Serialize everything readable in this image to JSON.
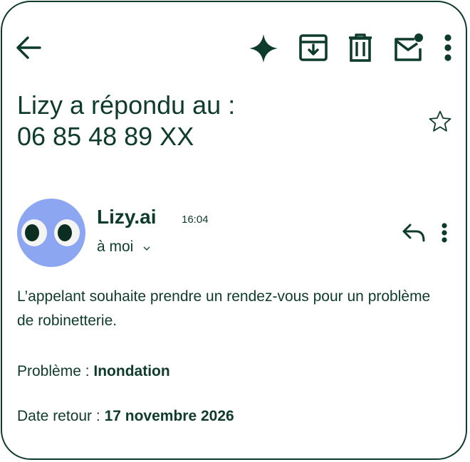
{
  "colors": {
    "ink": "#0e3b2c",
    "avatar_bg": "#8da6f2",
    "background": "#ffffff"
  },
  "toolbar": {
    "back_icon": "arrow-left-icon",
    "ai_icon": "sparkle-icon",
    "archive_icon": "archive-icon",
    "delete_icon": "trash-icon",
    "mark_unread_icon": "mail-unread-icon",
    "more_icon": "more-vert-icon"
  },
  "email": {
    "subject_line1": "Lizy a répondu au :",
    "subject_line2": "06 85 48 89 XX",
    "star_icon": "star-outline-icon",
    "sender": "Lizy.ai",
    "time": "16:04",
    "recipient": "à moi",
    "reply_icon": "reply-icon",
    "body": "L’appelant souhaite prendre un rendez-vous pour un problème de robinetterie.",
    "fields": [
      {
        "label": "Problème : ",
        "value": "Inondation"
      },
      {
        "label": "Date retour : ",
        "value": "17 novembre 2026"
      }
    ]
  }
}
